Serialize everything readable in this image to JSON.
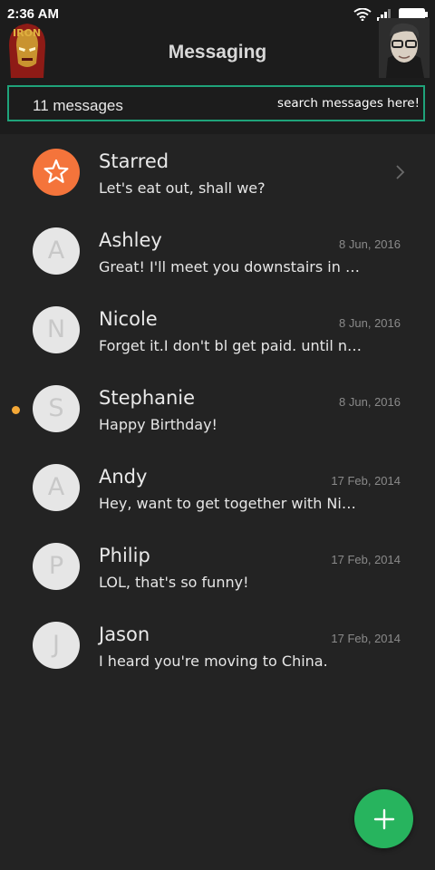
{
  "status_bar": {
    "time": "2:36 AM"
  },
  "header": {
    "title": "Messaging",
    "message_count": "11 messages",
    "search_placeholder": "search messages here!"
  },
  "conversations": [
    {
      "name": "Starred",
      "preview": "Let's eat out, shall we?",
      "date": "",
      "initial": "",
      "starred": true,
      "unread": false
    },
    {
      "name": "Ashley",
      "preview": "Great! I'll meet you downstairs in te…",
      "date": "8 Jun, 2016",
      "initial": "A",
      "starred": false,
      "unread": false
    },
    {
      "name": "Nicole",
      "preview": "Forget it.I don't bl get paid. until ne…",
      "date": "8 Jun, 2016",
      "initial": "N",
      "starred": false,
      "unread": false
    },
    {
      "name": "Stephanie",
      "preview": "Happy Birthday!",
      "date": "8 Jun, 2016",
      "initial": "S",
      "starred": false,
      "unread": true
    },
    {
      "name": "Andy",
      "preview": "Hey, want to get together with Nic…",
      "date": "17 Feb, 2014",
      "initial": "A",
      "starred": false,
      "unread": false
    },
    {
      "name": "Philip",
      "preview": "LOL, that's so funny!",
      "date": "17 Feb, 2014",
      "initial": "P",
      "starred": false,
      "unread": false
    },
    {
      "name": "Jason",
      "preview": "I heard you're moving to China.",
      "date": "17 Feb, 2014",
      "initial": "J",
      "starred": false,
      "unread": false
    }
  ],
  "colors": {
    "background": "#232323",
    "accent_border": "#1fa37a",
    "starred_avatar": "#f4743b",
    "unread_dot": "#f4a837",
    "fab": "#27b45e"
  },
  "icons": {
    "starred": "star-icon",
    "compose": "plus-icon",
    "more": "chevron-right-icon"
  }
}
